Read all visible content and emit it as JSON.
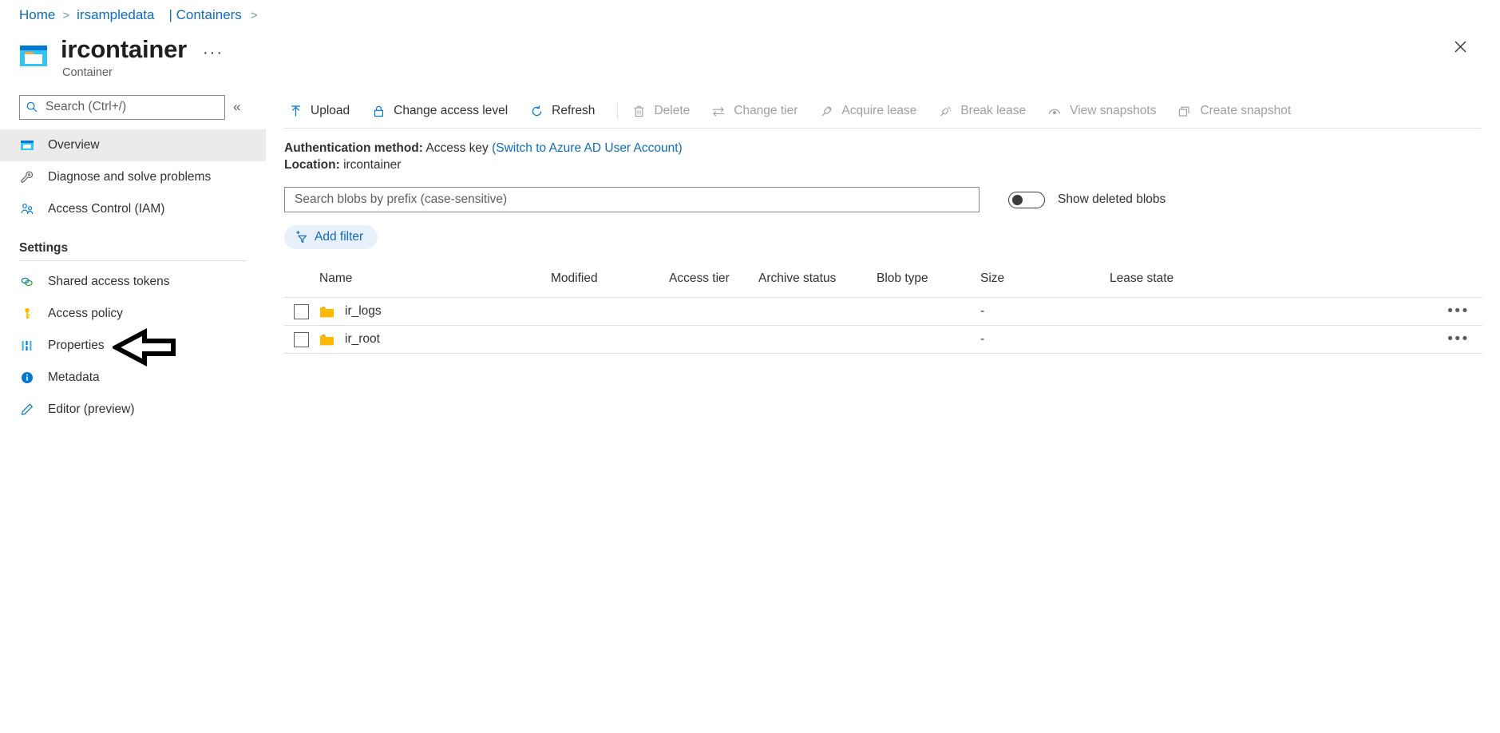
{
  "breadcrumb": {
    "home": "Home",
    "account": "irsampledata",
    "containers": "| Containers"
  },
  "header": {
    "title": "ircontainer",
    "subtitle": "Container",
    "ellipsis": "···",
    "close_icon": "close-icon"
  },
  "sidebar": {
    "search_placeholder": "Search (Ctrl+/)",
    "search_value": "",
    "collapse_label": "«",
    "items": [
      {
        "label": "Overview",
        "icon": "overview-icon",
        "selected": true
      },
      {
        "label": "Diagnose and solve problems",
        "icon": "wrench-icon",
        "selected": false
      },
      {
        "label": "Access Control (IAM)",
        "icon": "people-icon",
        "selected": false
      }
    ],
    "settings_header": "Settings",
    "settings_items": [
      {
        "label": "Shared access tokens",
        "icon": "link-icon"
      },
      {
        "label": "Access policy",
        "icon": "key-icon"
      },
      {
        "label": "Properties",
        "icon": "sliders-icon"
      },
      {
        "label": "Metadata",
        "icon": "info-icon"
      },
      {
        "label": "Editor (preview)",
        "icon": "pencil-icon"
      }
    ]
  },
  "toolbar": {
    "buttons": [
      {
        "label": "Upload",
        "icon": "upload-icon",
        "disabled": false
      },
      {
        "label": "Change access level",
        "icon": "lock-icon",
        "disabled": false
      },
      {
        "label": "Refresh",
        "icon": "refresh-icon",
        "disabled": false
      },
      {
        "label": "Delete",
        "icon": "trash-icon",
        "disabled": true
      },
      {
        "label": "Change tier",
        "icon": "swap-icon",
        "disabled": true
      },
      {
        "label": "Acquire lease",
        "icon": "plug-icon",
        "disabled": true
      },
      {
        "label": "Break lease",
        "icon": "plug-broken-icon",
        "disabled": true
      },
      {
        "label": "View snapshots",
        "icon": "snapshot-view-icon",
        "disabled": true
      },
      {
        "label": "Create snapshot",
        "icon": "snapshot-create-icon",
        "disabled": true
      }
    ]
  },
  "info": {
    "auth_label": "Authentication method:",
    "auth_value": "Access key",
    "auth_link": "(Switch to Azure AD User Account)",
    "location_label": "Location:",
    "location_value": "ircontainer"
  },
  "filters": {
    "search_placeholder": "Search blobs by prefix (case-sensitive)",
    "search_value": "",
    "toggle_label": "Show deleted blobs",
    "toggle_on": false,
    "add_filter_label": "Add filter",
    "add_filter_icon": "add-filter-icon"
  },
  "table": {
    "columns": [
      "Name",
      "Modified",
      "Access tier",
      "Archive status",
      "Blob type",
      "Size",
      "Lease state"
    ],
    "rows": [
      {
        "name": "ir_logs",
        "icon": "folder-icon",
        "modified": "",
        "access_tier": "",
        "archive_status": "",
        "blob_type": "",
        "size": "-",
        "lease_state": "",
        "menu": "•••"
      },
      {
        "name": "ir_root",
        "icon": "folder-icon",
        "modified": "",
        "access_tier": "",
        "archive_status": "",
        "blob_type": "",
        "size": "-",
        "lease_state": "",
        "menu": "•••"
      }
    ]
  },
  "annotation": {
    "arrow": "left-arrow-annotation"
  },
  "colors": {
    "accent": "#0078d4",
    "link": "#0f6cbd",
    "selected_bg": "#edebe9",
    "folder": "#ffb900",
    "border": "#e1dfdd"
  }
}
